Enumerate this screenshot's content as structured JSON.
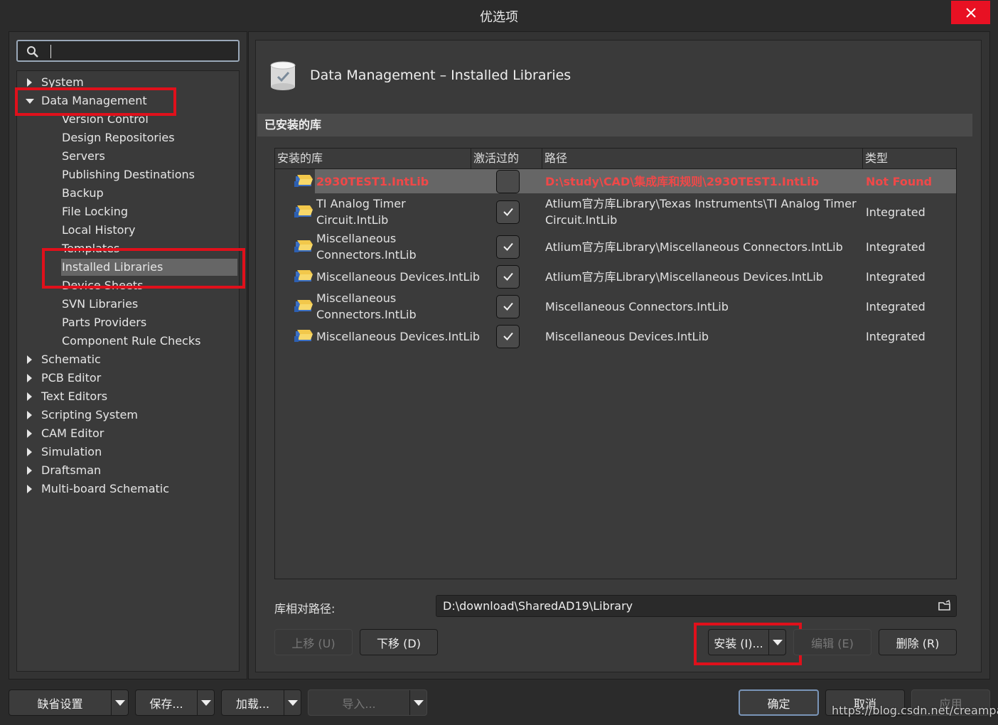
{
  "window": {
    "title": "优选项",
    "close_label": "close"
  },
  "search": {
    "placeholder": ""
  },
  "tree": {
    "items": [
      {
        "label": "System",
        "level": 0,
        "expanded": false
      },
      {
        "label": "Data Management",
        "level": 0,
        "expanded": true
      },
      {
        "label": "Version Control",
        "level": 1
      },
      {
        "label": "Design Repositories",
        "level": 1
      },
      {
        "label": "Servers",
        "level": 1
      },
      {
        "label": "Publishing Destinations",
        "level": 1
      },
      {
        "label": "Backup",
        "level": 1
      },
      {
        "label": "File Locking",
        "level": 1
      },
      {
        "label": "Local History",
        "level": 1
      },
      {
        "label": "Templates",
        "level": 1
      },
      {
        "label": "Installed Libraries",
        "level": 1,
        "selected": true
      },
      {
        "label": "Device Sheets",
        "level": 1
      },
      {
        "label": "SVN Libraries",
        "level": 1
      },
      {
        "label": "Parts Providers",
        "level": 1
      },
      {
        "label": "Component Rule Checks",
        "level": 1
      },
      {
        "label": "Schematic",
        "level": 0,
        "expanded": false
      },
      {
        "label": "PCB Editor",
        "level": 0,
        "expanded": false
      },
      {
        "label": "Text Editors",
        "level": 0,
        "expanded": false
      },
      {
        "label": "Scripting System",
        "level": 0,
        "expanded": false
      },
      {
        "label": "CAM Editor",
        "level": 0,
        "expanded": false
      },
      {
        "label": "Simulation",
        "level": 0,
        "expanded": false
      },
      {
        "label": "Draftsman",
        "level": 0,
        "expanded": false
      },
      {
        "label": "Multi-board Schematic",
        "level": 0,
        "expanded": false
      }
    ]
  },
  "page": {
    "title": "Data Management – Installed Libraries",
    "section": "已安装的库"
  },
  "table": {
    "columns": [
      "安装的库",
      "激活过的",
      "路径",
      "类型"
    ],
    "rows": [
      {
        "name_line1": "2930TEST1.IntLib",
        "name_line2": "",
        "active": false,
        "path_line1": "D:\\study\\CAD\\集成库和规则\\2930TEST1.IntLib",
        "path_line2": "",
        "type": "Not Found",
        "not_found": true
      },
      {
        "name_line1": "TI Analog Timer",
        "name_line2": "Circuit.IntLib",
        "active": true,
        "path_line1": "Atlium官方库Library\\Texas Instruments\\TI Analog Timer",
        "path_line2": "Circuit.IntLib",
        "type": "Integrated"
      },
      {
        "name_line1": "Miscellaneous",
        "name_line2": "Connectors.IntLib",
        "active": true,
        "path_line1": "Atlium官方库Library\\Miscellaneous Connectors.IntLib",
        "path_line2": "",
        "type": "Integrated"
      },
      {
        "name_line1": "Miscellaneous Devices.IntLib",
        "name_line2": "",
        "active": true,
        "path_line1": "Atlium官方库Library\\Miscellaneous Devices.IntLib",
        "path_line2": "",
        "type": "Integrated"
      },
      {
        "name_line1": "Miscellaneous",
        "name_line2": "Connectors.IntLib",
        "active": true,
        "path_line1": "Miscellaneous Connectors.IntLib",
        "path_line2": "",
        "type": "Integrated"
      },
      {
        "name_line1": "Miscellaneous Devices.IntLib",
        "name_line2": "",
        "active": true,
        "path_line1": "Miscellaneous Devices.IntLib",
        "path_line2": "",
        "type": "Integrated"
      }
    ]
  },
  "relative_path": {
    "label": "库相对路径:",
    "value": "D:\\download\\SharedAD19\\Library"
  },
  "buttons": {
    "move_up": "上移 (U)",
    "move_down": "下移 (D)",
    "install": "安装 (I)...",
    "edit": "编辑 (E)",
    "delete": "删除 (R)",
    "defaults": "缺省设置",
    "save": "保存...",
    "load": "加载...",
    "import": "导入...",
    "ok": "确定",
    "cancel": "取消",
    "apply": "应用"
  },
  "watermark": "https://blog.csdn.net/creampang",
  "colors": {
    "highlight": "#e0101b",
    "not_found": "#f04848",
    "close": "#e81123"
  }
}
